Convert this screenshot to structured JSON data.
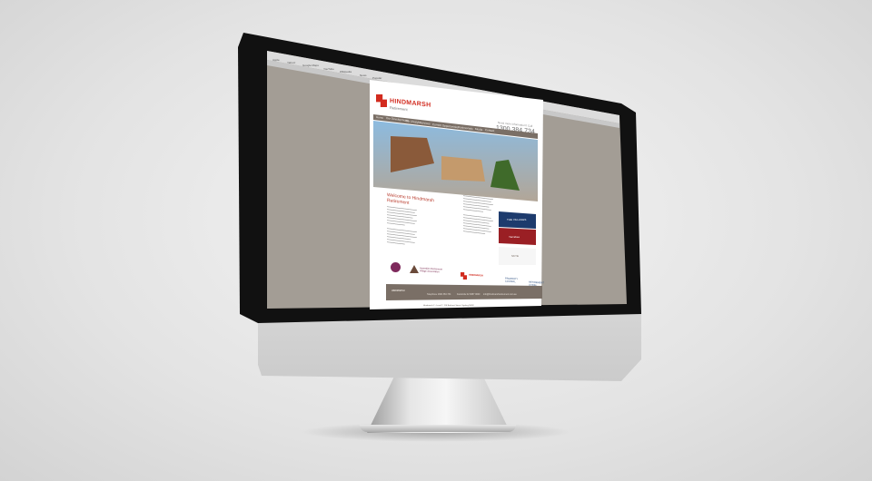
{
  "browser": {
    "bookmarks": [
      "Apple",
      "Yahoo!",
      "Google Maps",
      "YouTube",
      "Wikipedia",
      "News",
      "Popular"
    ]
  },
  "site": {
    "brand": "HINDMARSH",
    "brand_sub": "Retirement",
    "phone_label": "Need more information? Call",
    "phone": "1300 384 734",
    "nav": [
      "Home",
      "Our Developments",
      "Our Lifestyle",
      "Services",
      "Current Opportunities",
      "Testimonials",
      "Media",
      "Contact"
    ],
    "welcome_heading": "Welcome to Hindmarsh Retirement",
    "ads": {
      "blue": "THE VILLAGES",
      "red": "Yarrabee",
      "white": "SKYE"
    },
    "partners": {
      "circle": "",
      "triangle": "Australian Retirement Village Association",
      "hindmarsh": "HINDMARSH",
      "property": "PROPERTY COUNCIL",
      "other": "RETIREMENT LIVING"
    },
    "footer": {
      "logo": "HINDMARSH",
      "address": "Hindmarsh 2 - Level 7, 116 Bathurst Street, Sydney NSW",
      "phone": "Telephone 1300 384 734",
      "fax": "Facsimile 02 9387 0000",
      "email": "info@hindmarshretirement.com.au"
    }
  }
}
